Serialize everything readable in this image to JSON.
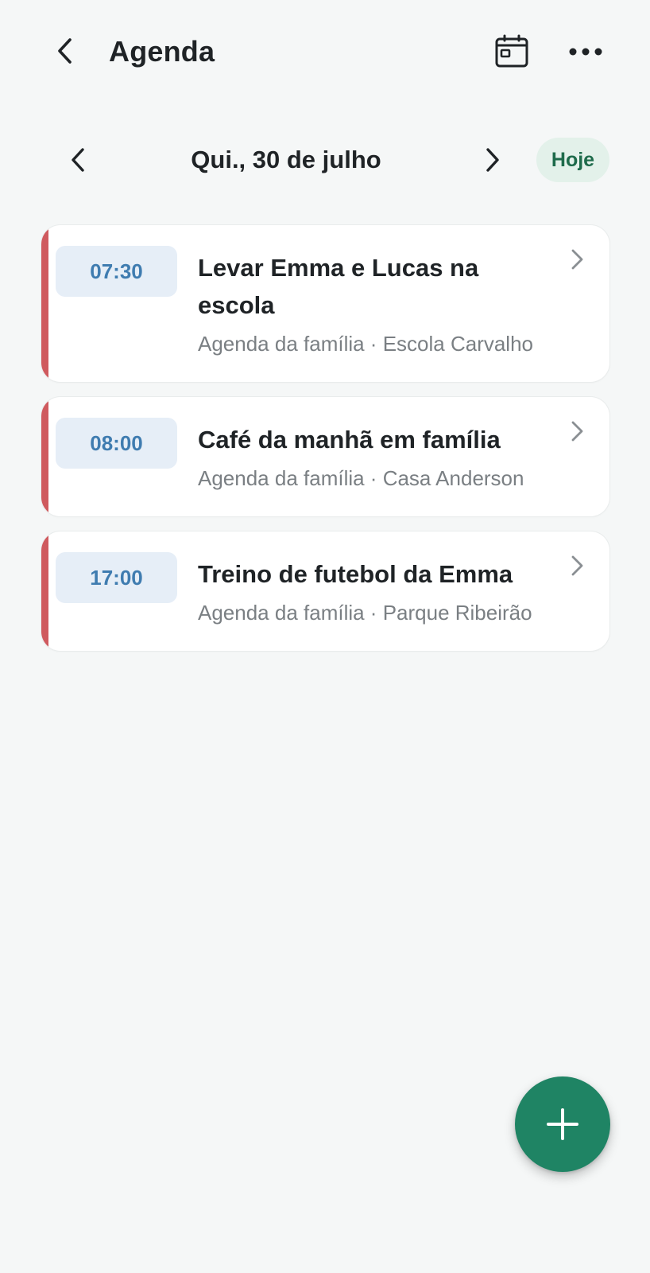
{
  "header": {
    "title": "Agenda",
    "icons": {
      "back": "chevron-left-icon",
      "calendar": "calendar-icon",
      "more": "more-horizontal-icon"
    }
  },
  "date_nav": {
    "date": "Qui., 30 de julho",
    "today_label": "Hoje",
    "icons": {
      "prev": "chevron-left-icon",
      "next": "chevron-right-icon"
    }
  },
  "events": [
    {
      "time": "07:30",
      "title": "Levar Emma e Lucas na escola",
      "subtitle": "Agenda da família · Escola Carvalho"
    },
    {
      "time": "08:00",
      "title": "Café da manhã em família",
      "subtitle": "Agenda da família · Casa Anderson"
    },
    {
      "time": "17:00",
      "title": "Treino de futebol da Emma",
      "subtitle": "Agenda da família · Parque Ribeirão"
    }
  ],
  "fab": {
    "icon": "plus-icon"
  },
  "colors": {
    "background": "#f5f7f7",
    "accent_event": "#cf5a5e",
    "time_chip_bg": "#e6eef7",
    "time_chip_text": "#3f7cb0",
    "today_chip_bg": "#e3f1ea",
    "today_chip_text": "#1e6b4b",
    "fab": "#1f8464"
  }
}
